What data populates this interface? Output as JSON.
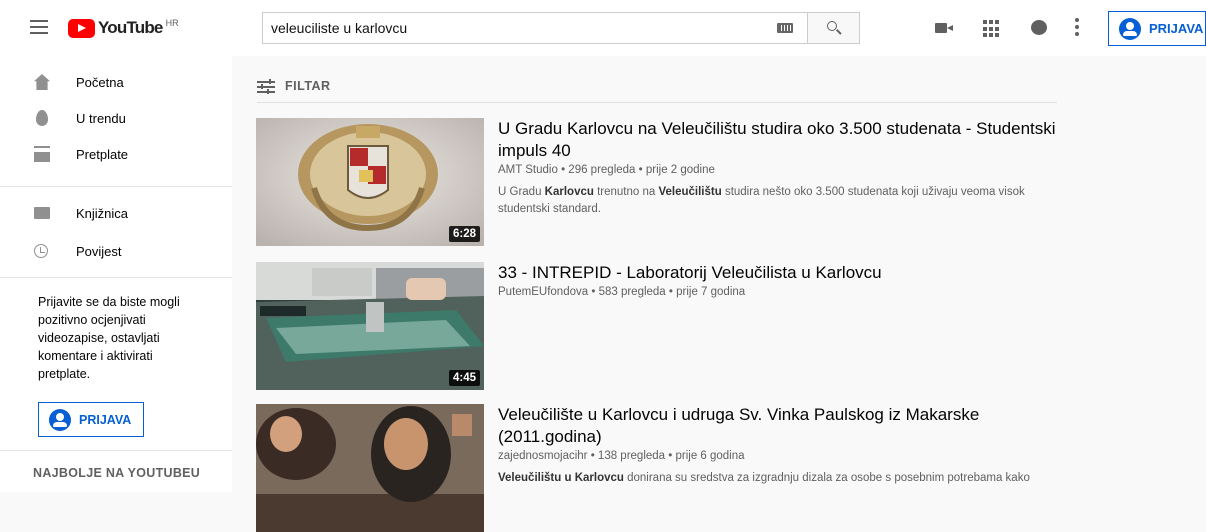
{
  "header": {
    "logo_text": "YouTube",
    "logo_region": "HR",
    "search_value": "veleuciliste u karlovcu",
    "signin_label": "PRIJAVA",
    "accent_color": "#065fd4",
    "brand_color": "#ff0000"
  },
  "sidebar": {
    "items": [
      {
        "label": "Početna",
        "icon": "home-icon"
      },
      {
        "label": "U trendu",
        "icon": "trending-icon"
      },
      {
        "label": "Pretplate",
        "icon": "subscriptions-icon"
      },
      {
        "label": "Knjižnica",
        "icon": "library-icon"
      },
      {
        "label": "Povijest",
        "icon": "history-icon"
      }
    ],
    "signin_note": "Prijavite se da biste mogli pozitivno ocjenjivati videozapise, ostavljati komentare i aktivirati pretplate.",
    "signin_label": "PRIJAVA",
    "section_heading": "NAJBOLJE NA YOUTUBEU"
  },
  "filter": {
    "label": "FILTAR"
  },
  "results": [
    {
      "title": "U Gradu Karlovcu na Veleučilištu studira oko 3.500 studenata - Studentski impuls 40",
      "channel": "AMT Studio",
      "meta": "296 pregleda • prije 2 godine",
      "description_parts": [
        "U Gradu ",
        "Karlovcu",
        " trenutno na ",
        "Veleučilištu",
        " studira nešto oko 3.500 studenata koji uživaju veoma visok studentski standard."
      ],
      "duration": "6:28"
    },
    {
      "title": "33 - INTREPID - Laboratorij Veleučilista u Karlovcu",
      "channel": "PutemEUfondova",
      "meta": "583 pregleda • prije 7 godina",
      "description_parts": [],
      "duration": "4:45"
    },
    {
      "title": "Veleučilište u Karlovcu i udruga Sv. Vinka Paulskog iz Makarske (2011.godina)",
      "channel": "zajednosmojacihr",
      "meta": "138 pregleda • prije 6 godina",
      "description_parts": [
        "Veleučilištu u Karlovcu",
        " donirana su sredstva za izgradnju dizala za osobe s posebnim potrebama kako"
      ],
      "duration": ""
    }
  ]
}
